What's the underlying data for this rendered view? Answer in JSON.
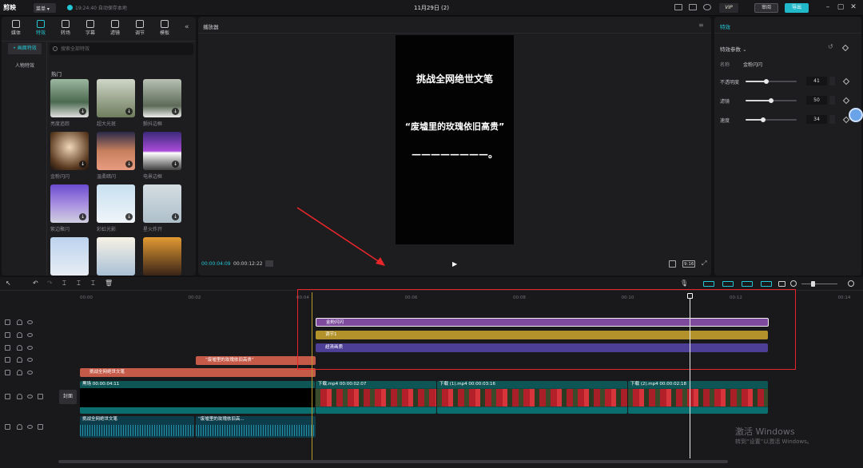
{
  "titlebar": {
    "app_name": "剪映",
    "menu_label": "菜单",
    "save_status": "19:24:40 自动保存本地",
    "project_title": "11月29日 (2)",
    "vip_label": "VIP",
    "review_label": "审阅",
    "export_label": "导出"
  },
  "left_tabs": [
    {
      "label": "媒体",
      "icon": "media-icon"
    },
    {
      "label": "特效",
      "icon": "effects-icon"
    },
    {
      "label": "转场",
      "icon": "transition-icon"
    },
    {
      "label": "字幕",
      "icon": "text-icon"
    },
    {
      "label": "滤镜",
      "icon": "filter-icon"
    },
    {
      "label": "调节",
      "icon": "adjust-icon"
    },
    {
      "label": "模板",
      "icon": "template-icon"
    }
  ],
  "effects_sidebar": {
    "items": [
      "• 画面特效",
      "人物特效"
    ]
  },
  "effects_search": {
    "placeholder": "搜索全部特效"
  },
  "effects_section": "热门",
  "effects_grid": [
    {
      "label": "亮度追踪"
    },
    {
      "label": "超大光斑"
    },
    {
      "label": "颤抖边框"
    },
    {
      "label": "金粉闪闪"
    },
    {
      "label": "温柔暗闪"
    },
    {
      "label": "电景边框"
    },
    {
      "label": "紫边聚闪"
    },
    {
      "label": "彩虹光影"
    },
    {
      "label": "星火炸开"
    },
    {
      "label": ""
    },
    {
      "label": ""
    },
    {
      "label": ""
    }
  ],
  "player": {
    "title": "播放器",
    "video_lines": [
      "挑战全网绝世文笔",
      "“废墟里的玫瑰依旧高贵”",
      "————————。"
    ],
    "current_time": "00:00:04:09",
    "total_time": "00:00:12:22",
    "ratio_label": "9:16"
  },
  "right_panel": {
    "title": "特效",
    "section": "特效参数 ⌄",
    "name_label": "名称",
    "name_value": "金粉闪闪",
    "params": [
      {
        "label": "不透明度",
        "value": "41",
        "fraction": 0.41
      },
      {
        "label": "滤镜",
        "value": "50",
        "fraction": 0.5
      },
      {
        "label": "速度",
        "value": "34",
        "fraction": 0.34
      }
    ]
  },
  "timeline": {
    "ruler": [
      "00:00",
      "00:02",
      "00:04",
      "00:06",
      "00:08",
      "00:10",
      "00:12",
      "00:14"
    ],
    "effect_clips": [
      "金粉闪闪",
      "调节1",
      "超清画质"
    ],
    "text_clips": [
      "“废墟里的玫瑰依旧高贵”",
      "挑战全网绝世文笔"
    ],
    "cover_label": "封面",
    "video_clips": [
      {
        "header": "黑场  00:00:04:11"
      },
      {
        "header": "下载.mp4  00:00:02:07"
      },
      {
        "header": "下载 (1).mp4  00:00:03:16"
      },
      {
        "header": "下载 (2).mp4  00:00:02:18"
      }
    ],
    "audio_clips": [
      "挑战全网绝世文笔",
      "“废墟里的玫瑰依旧高..."
    ]
  },
  "watermark": {
    "line1": "激活 Windows",
    "line2": "转到“设置”以激活 Windows。"
  },
  "colors": {
    "accent": "#23c6d3",
    "effect_purple": "#7d4a9e",
    "adjust_gold": "#b3922c",
    "quality_indigo": "#4d3f96",
    "text_clip_red": "#c65a48",
    "annotation_red": "#e8262a"
  }
}
